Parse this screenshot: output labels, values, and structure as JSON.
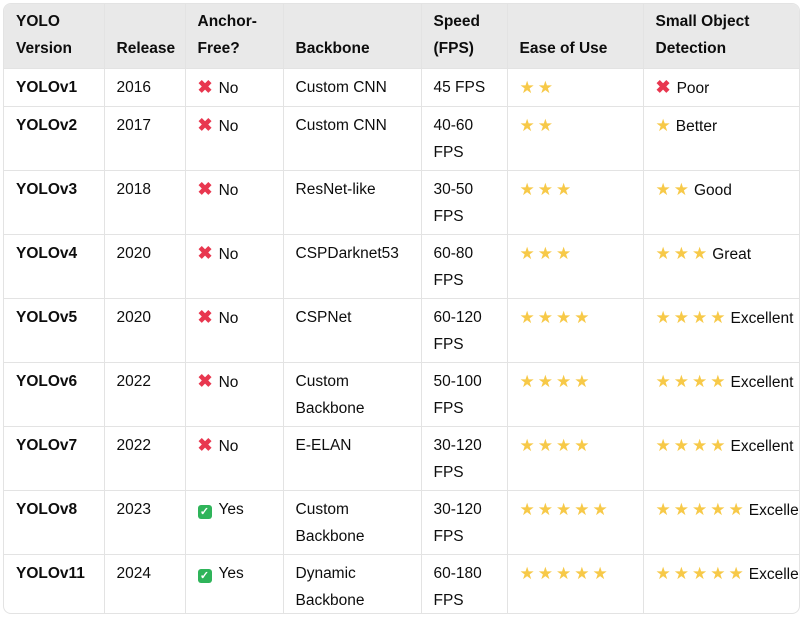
{
  "headers": [
    "YOLO Version",
    "Release",
    "Anchor-Free?",
    "Backbone",
    "Speed (FPS)",
    "Ease of Use",
    "Small Object Detection"
  ],
  "rows": [
    {
      "version": "YOLOv1",
      "release": "2016",
      "anchor": {
        "icon": "x-mark-icon",
        "text": "No"
      },
      "backbone": "Custom CNN",
      "speed": "45 FPS",
      "ease_stars": 2,
      "small": {
        "icon": "x-mark-icon",
        "stars": 0,
        "text": "Poor"
      }
    },
    {
      "version": "YOLOv2",
      "release": "2017",
      "anchor": {
        "icon": "x-mark-icon",
        "text": "No"
      },
      "backbone": "Custom CNN",
      "speed": "40-60 FPS",
      "ease_stars": 2,
      "small": {
        "icon": "star-icon",
        "stars": 1,
        "text": "Better"
      }
    },
    {
      "version": "YOLOv3",
      "release": "2018",
      "anchor": {
        "icon": "x-mark-icon",
        "text": "No"
      },
      "backbone": "ResNet-like",
      "speed": "30-50 FPS",
      "ease_stars": 3,
      "small": {
        "icon": "star-icon",
        "stars": 2,
        "text": "Good"
      }
    },
    {
      "version": "YOLOv4",
      "release": "2020",
      "anchor": {
        "icon": "x-mark-icon",
        "text": "No"
      },
      "backbone": "CSPDarknet53",
      "speed": "60-80 FPS",
      "ease_stars": 3,
      "small": {
        "icon": "star-icon",
        "stars": 3,
        "text": "Great"
      }
    },
    {
      "version": "YOLOv5",
      "release": "2020",
      "anchor": {
        "icon": "x-mark-icon",
        "text": "No"
      },
      "backbone": "CSPNet",
      "speed": "60-120 FPS",
      "ease_stars": 4,
      "small": {
        "icon": "star-icon",
        "stars": 4,
        "text": "Excellent"
      }
    },
    {
      "version": "YOLOv6",
      "release": "2022",
      "anchor": {
        "icon": "x-mark-icon",
        "text": "No"
      },
      "backbone": "Custom Backbone",
      "speed": "50-100 FPS",
      "ease_stars": 4,
      "small": {
        "icon": "star-icon",
        "stars": 4,
        "text": "Excellent"
      }
    },
    {
      "version": "YOLOv7",
      "release": "2022",
      "anchor": {
        "icon": "x-mark-icon",
        "text": "No"
      },
      "backbone": "E-ELAN",
      "speed": "30-120 FPS",
      "ease_stars": 4,
      "small": {
        "icon": "star-icon",
        "stars": 4,
        "text": "Excellent"
      }
    },
    {
      "version": "YOLOv8",
      "release": "2023",
      "anchor": {
        "icon": "check-icon",
        "text": "Yes"
      },
      "backbone": "Custom Backbone",
      "speed": "30-120 FPS",
      "ease_stars": 5,
      "small": {
        "icon": "star-icon",
        "stars": 5,
        "text": "Excellent"
      }
    },
    {
      "version": "YOLOv11",
      "release": "2024",
      "anchor": {
        "icon": "check-icon",
        "text": "Yes"
      },
      "backbone": "Dynamic Backbone",
      "speed": "60-180 FPS",
      "ease_stars": 5,
      "small": {
        "icon": "star-icon",
        "stars": 5,
        "text": "Excellent"
      }
    }
  ],
  "colors": {
    "star": "#f7c948",
    "x_mark": "#e8374f",
    "check": "#2fb45a",
    "header_bg": "#e9e9e9",
    "border": "#e3e3e3"
  }
}
